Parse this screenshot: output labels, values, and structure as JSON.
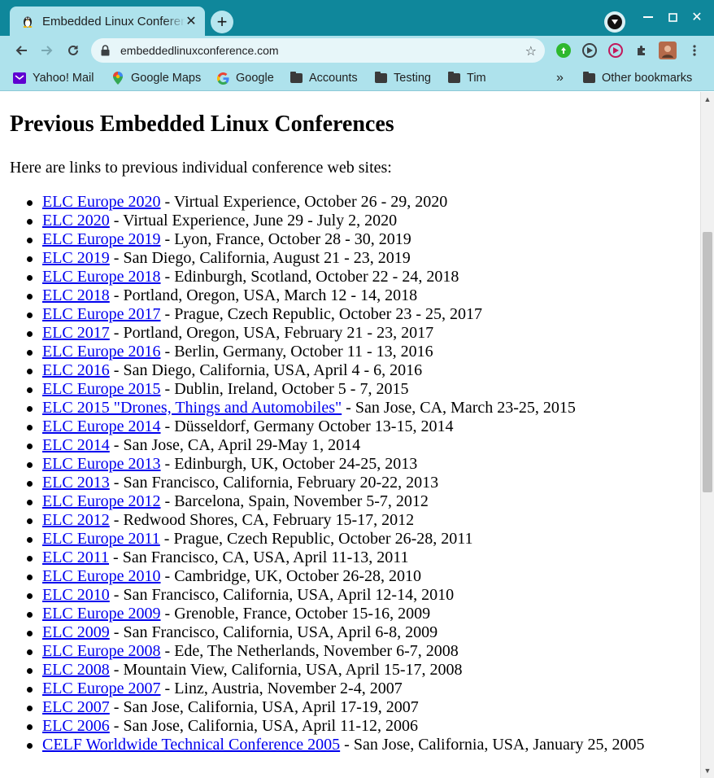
{
  "browser": {
    "tab_title": "Embedded Linux Conference",
    "url": "embeddedlinuxconference.com",
    "theme_color": "#0f879b",
    "bookmarks": [
      {
        "label": "Yahoo! Mail",
        "icon": "yahoo-icon"
      },
      {
        "label": "Google Maps",
        "icon": "google-maps-icon"
      },
      {
        "label": "Google",
        "icon": "google-icon"
      },
      {
        "label": "Accounts",
        "icon": "folder-icon"
      },
      {
        "label": "Testing",
        "icon": "folder-icon"
      },
      {
        "label": "Tim",
        "icon": "folder-icon"
      }
    ],
    "overflow_label": "»",
    "other_bookmarks": "Other bookmarks"
  },
  "page": {
    "title": "Previous Embedded Linux Conferences",
    "intro": "Here are links to previous individual conference web sites:",
    "link_color": "#0000ee",
    "conferences": [
      {
        "link": "ELC Europe  2020",
        "details": " - Virtual Experience, October 26 - 29, 2020"
      },
      {
        "link": "ELC 2020",
        "details": " - Virtual Experience, June 29 - July 2, 2020"
      },
      {
        "link": "ELC Europe  2019",
        "details": " - Lyon, France, October 28 - 30, 2019"
      },
      {
        "link": "ELC 2019",
        "details": " - San Diego, California, August 21 - 23, 2019"
      },
      {
        "link": "ELC Europe 2018",
        "details": " - Edinburgh, Scotland, October 22 - 24, 2018"
      },
      {
        "link": "ELC 2018",
        "details": " - Portland, Oregon, USA, March 12 - 14, 2018"
      },
      {
        "link": "ELC Europe 2017",
        "details": " - Prague, Czech Republic, October 23 - 25, 2017"
      },
      {
        "link": "ELC 2017",
        "details": " - Portland, Oregon, USA, February 21 - 23, 2017"
      },
      {
        "link": "ELC Europe 2016",
        "details": " - Berlin, Germany, October 11 - 13, 2016"
      },
      {
        "link": "ELC 2016",
        "details": " - San Diego, California, USA, April 4 - 6, 2016"
      },
      {
        "link": "ELC Europe 2015",
        "details": " - Dublin, Ireland, October 5 - 7, 2015"
      },
      {
        "link": "ELC 2015 \"Drones, Things and Automobiles\"",
        "details": " - San Jose, CA, March 23-25, 2015"
      },
      {
        "link": "ELC Europe 2014",
        "details": " - Düsseldorf, Germany October 13-15, 2014"
      },
      {
        "link": "ELC 2014",
        "details": " - San Jose, CA, April 29-May 1, 2014"
      },
      {
        "link": "ELC Europe 2013",
        "details": " - Edinburgh, UK, October 24-25, 2013"
      },
      {
        "link": "ELC 2013",
        "details": " - San Francisco, California, February 20-22, 2013"
      },
      {
        "link": "ELC Europe 2012",
        "details": " - Barcelona, Spain, November 5-7, 2012"
      },
      {
        "link": "ELC 2012",
        "details": " - Redwood Shores, CA, February 15-17, 2012"
      },
      {
        "link": "ELC Europe 2011",
        "details": " - Prague, Czech Republic, October 26-28, 2011"
      },
      {
        "link": "ELC 2011",
        "details": " - San Francisco, CA, USA, April 11-13, 2011"
      },
      {
        "link": "ELC Europe 2010",
        "details": " - Cambridge, UK, October 26-28, 2010"
      },
      {
        "link": "ELC 2010",
        "details": " - San Francisco, California, USA, April 12-14, 2010"
      },
      {
        "link": "ELC Europe 2009",
        "details": " - Grenoble, France, October 15-16, 2009"
      },
      {
        "link": "ELC 2009",
        "details": " - San Francisco, California, USA, April 6-8, 2009"
      },
      {
        "link": "ELC Europe 2008",
        "details": " - Ede, The Netherlands, November 6-7, 2008"
      },
      {
        "link": "ELC 2008",
        "details": " - Mountain View, California, USA, April 15-17, 2008"
      },
      {
        "link": "ELC Europe 2007",
        "details": " - Linz, Austria, November 2-4, 2007"
      },
      {
        "link": "ELC 2007",
        "details": " - San Jose, California, USA, April 17-19, 2007"
      },
      {
        "link": "ELC 2006",
        "details": " - San Jose, California, USA, April 11-12, 2006"
      },
      {
        "link": "CELF Worldwide Technical Conference 2005",
        "details": " - San Jose, California, USA, January 25, 2005"
      }
    ]
  }
}
